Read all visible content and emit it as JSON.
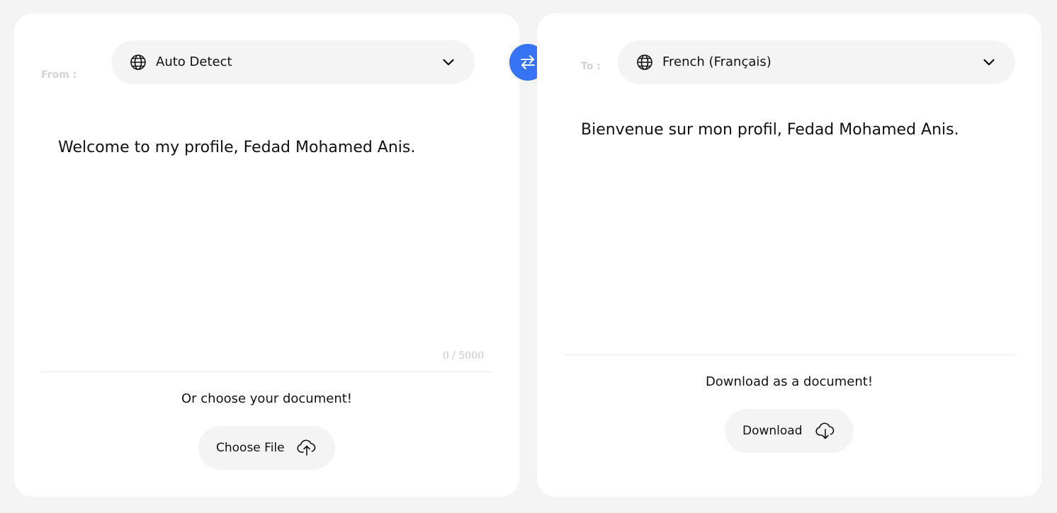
{
  "source": {
    "from_label": "From :",
    "language": "Auto Detect",
    "text": "Welcome to my profile, Fedad Mohamed Anis.",
    "char_count": "0 / 5000",
    "document_prompt": "Or choose your document!",
    "choose_file_label": "Choose File"
  },
  "target": {
    "to_label": "To :",
    "language": "French (Français)",
    "text": "Bienvenue sur mon profil, Fedad Mohamed Anis.",
    "document_prompt": "Download as a document!",
    "download_label": "Download"
  },
  "colors": {
    "accent": "#3773f5",
    "background": "#f4f4f4",
    "panel": "#ffffff",
    "muted_label": "#d2d2d2"
  },
  "icons": {
    "language_select": "globe-icon",
    "dropdown": "chevron-down-icon",
    "swap": "swap-arrows-icon",
    "upload": "cloud-upload-icon",
    "download": "cloud-download-icon"
  }
}
